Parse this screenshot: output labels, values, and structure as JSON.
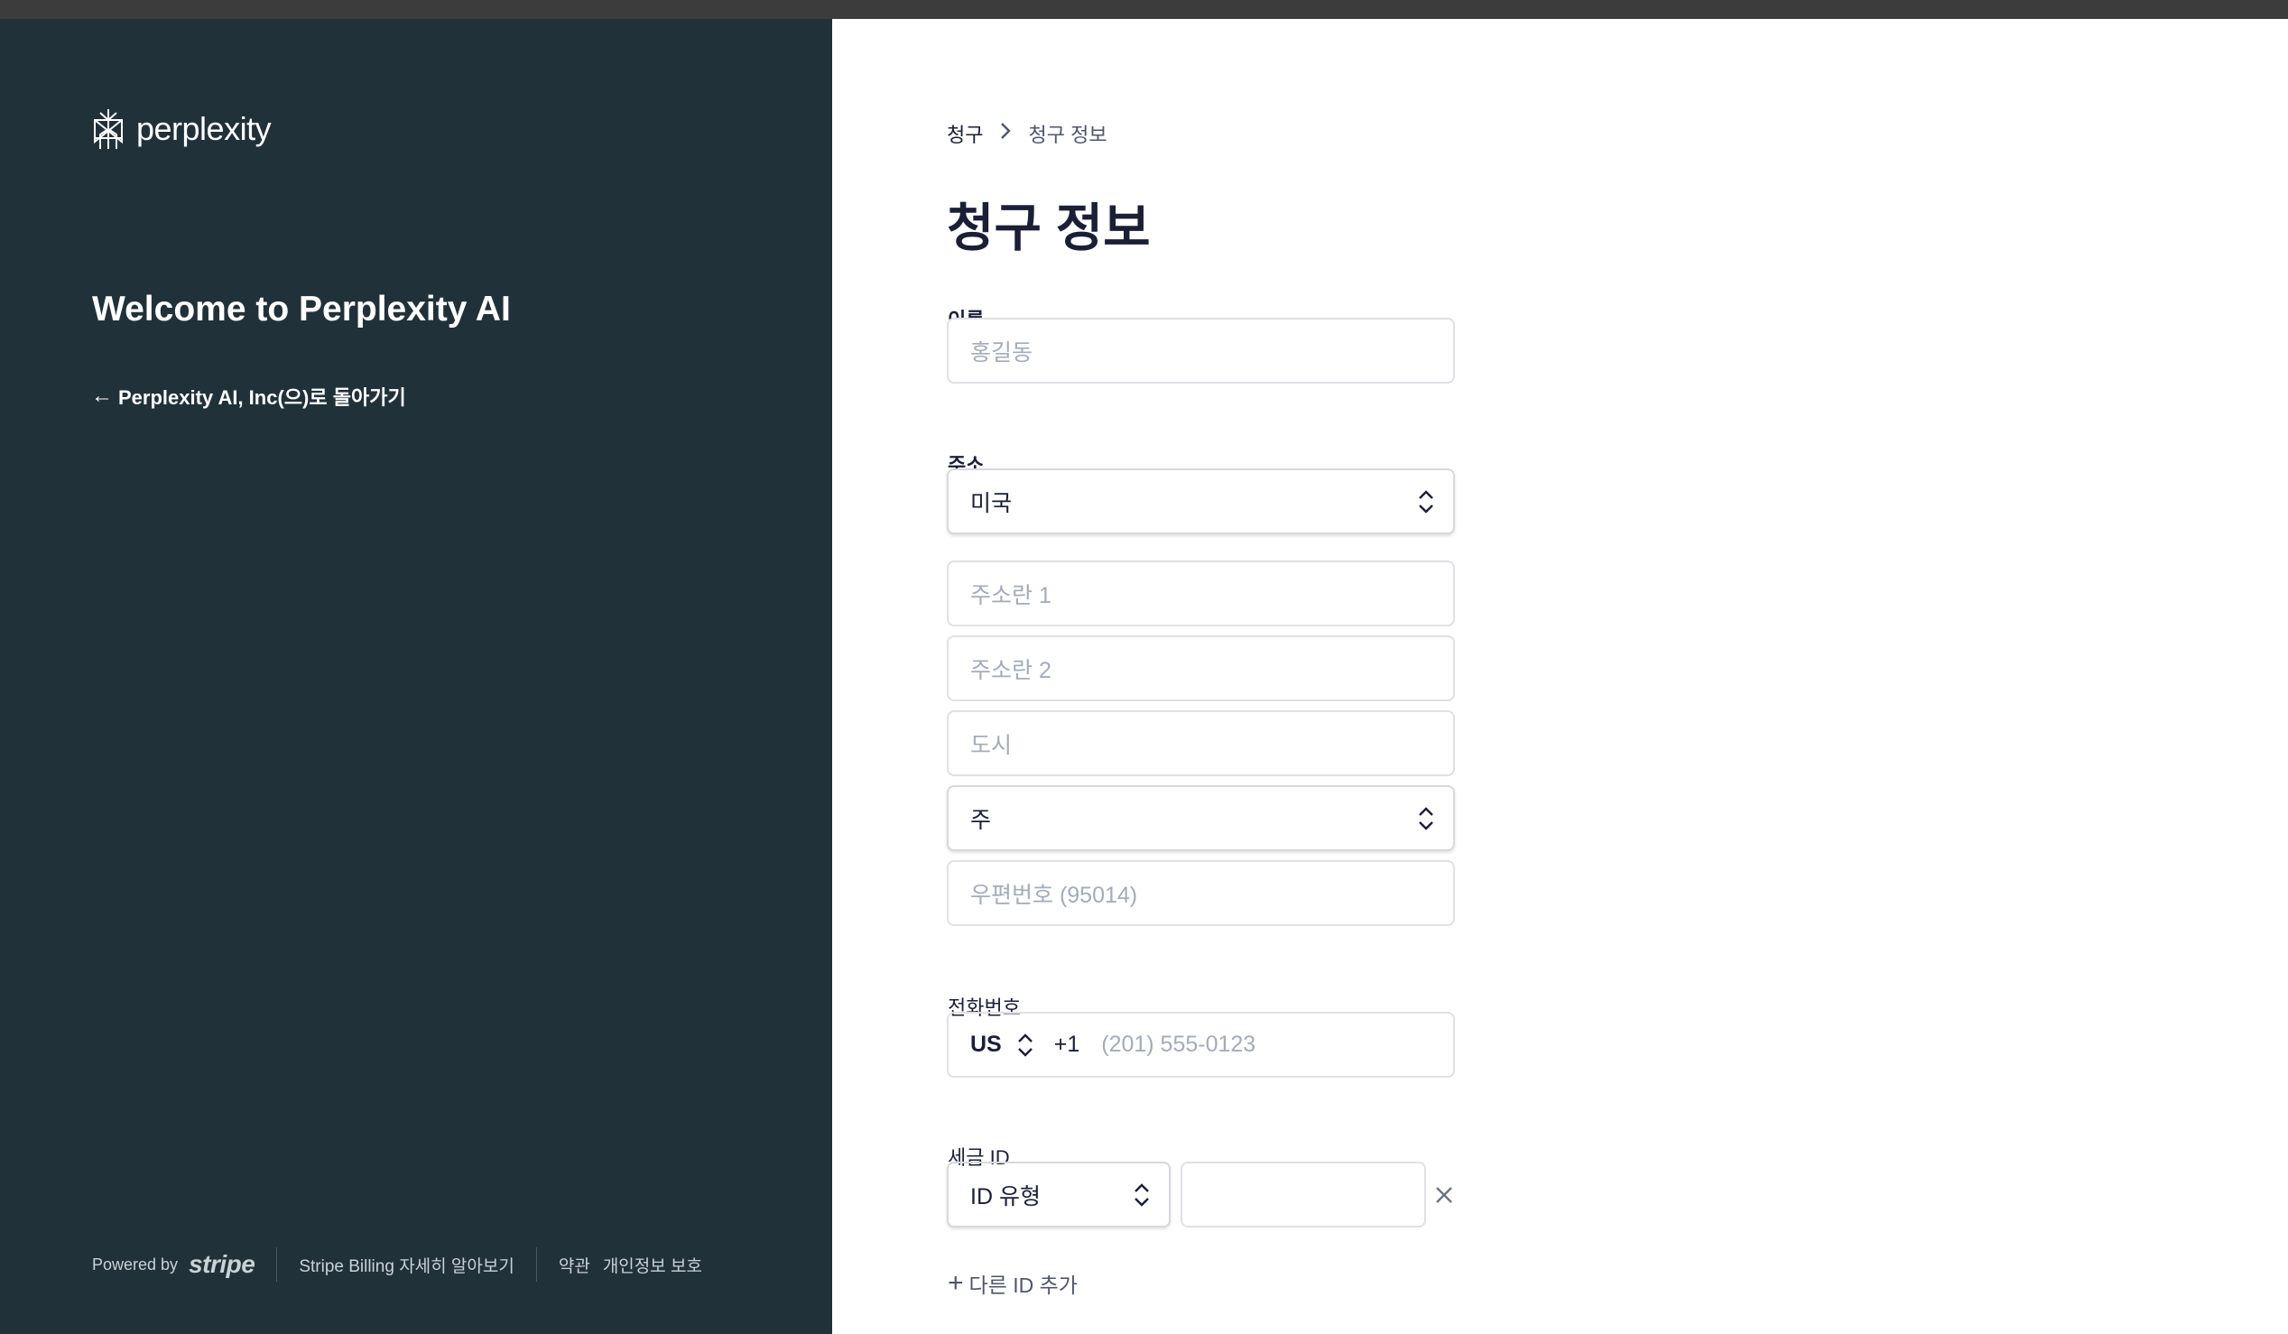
{
  "brand": {
    "wordmark": "perplexity",
    "welcome": "Welcome to Perplexity AI",
    "back_link": "Perplexity AI, Inc(으)로 돌아가기",
    "dark_panel_color": "#21313a"
  },
  "footer": {
    "powered_by": "Powered by",
    "stripe": "stripe",
    "learn_more": "Stripe Billing 자세히 알아보기",
    "terms": "약관",
    "privacy": "개인정보 보호"
  },
  "breadcrumb": {
    "root": "청구",
    "current": "청구 정보"
  },
  "page_title": "청구 정보",
  "form": {
    "name_label": "이름",
    "name_placeholder": "홍길동",
    "address_label": "주소",
    "country_value": "미국",
    "address1_placeholder": "주소란 1",
    "address2_placeholder": "주소란 2",
    "city_placeholder": "도시",
    "state_value": "주",
    "zip_placeholder": "우편번호 (95014)",
    "phone_label": "전화번호",
    "phone_country": "US",
    "phone_dial": "+1",
    "phone_placeholder": "(201) 555-0123",
    "tax_label": "세금 ID",
    "tax_type_value": "ID 유형",
    "add_id_label": "다른 ID 추가"
  },
  "icons": {
    "logo": "perplexity-logo-icon",
    "back": "arrow-left-icon",
    "chevron": "chevron-right-icon",
    "updown": "chevron-updown-icon",
    "close": "close-icon",
    "plus": "plus-icon"
  }
}
